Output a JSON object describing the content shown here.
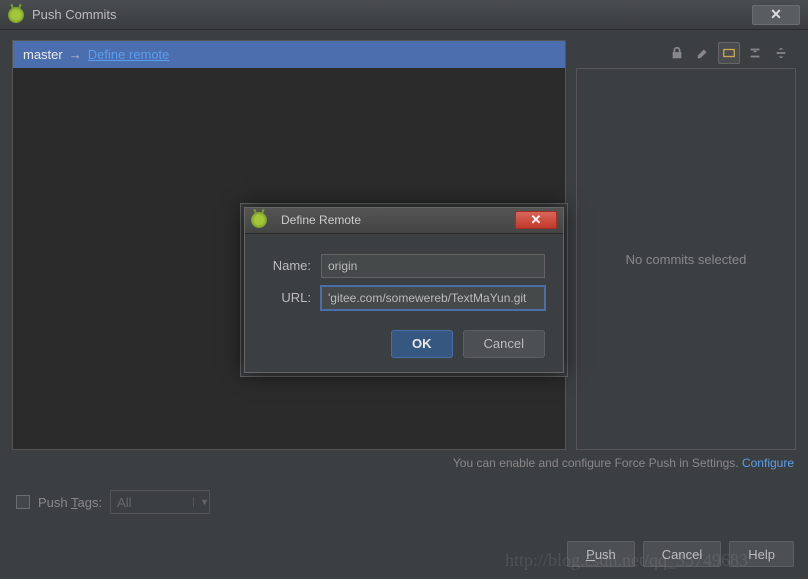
{
  "window": {
    "title": "Push Commits"
  },
  "branch": {
    "name": "master",
    "arrow": "→",
    "remote_link": "Define remote"
  },
  "right_panel": {
    "empty_text": "No commits selected"
  },
  "hint": {
    "text": "You can enable and configure Force Push in Settings. ",
    "link": "Configure"
  },
  "push_tags": {
    "label": "Push Tags:",
    "selected": "All"
  },
  "buttons": {
    "push": "Push",
    "cancel": "Cancel",
    "help": "Help"
  },
  "modal": {
    "title": "Define Remote",
    "name_label": "Name:",
    "name_value": "origin",
    "url_label": "URL:",
    "url_value": "'gitee.com/somewereb/TextMaYun.git",
    "ok": "OK",
    "cancel": "Cancel"
  },
  "watermark": "http://blog.csdn.net/qq_35749683"
}
